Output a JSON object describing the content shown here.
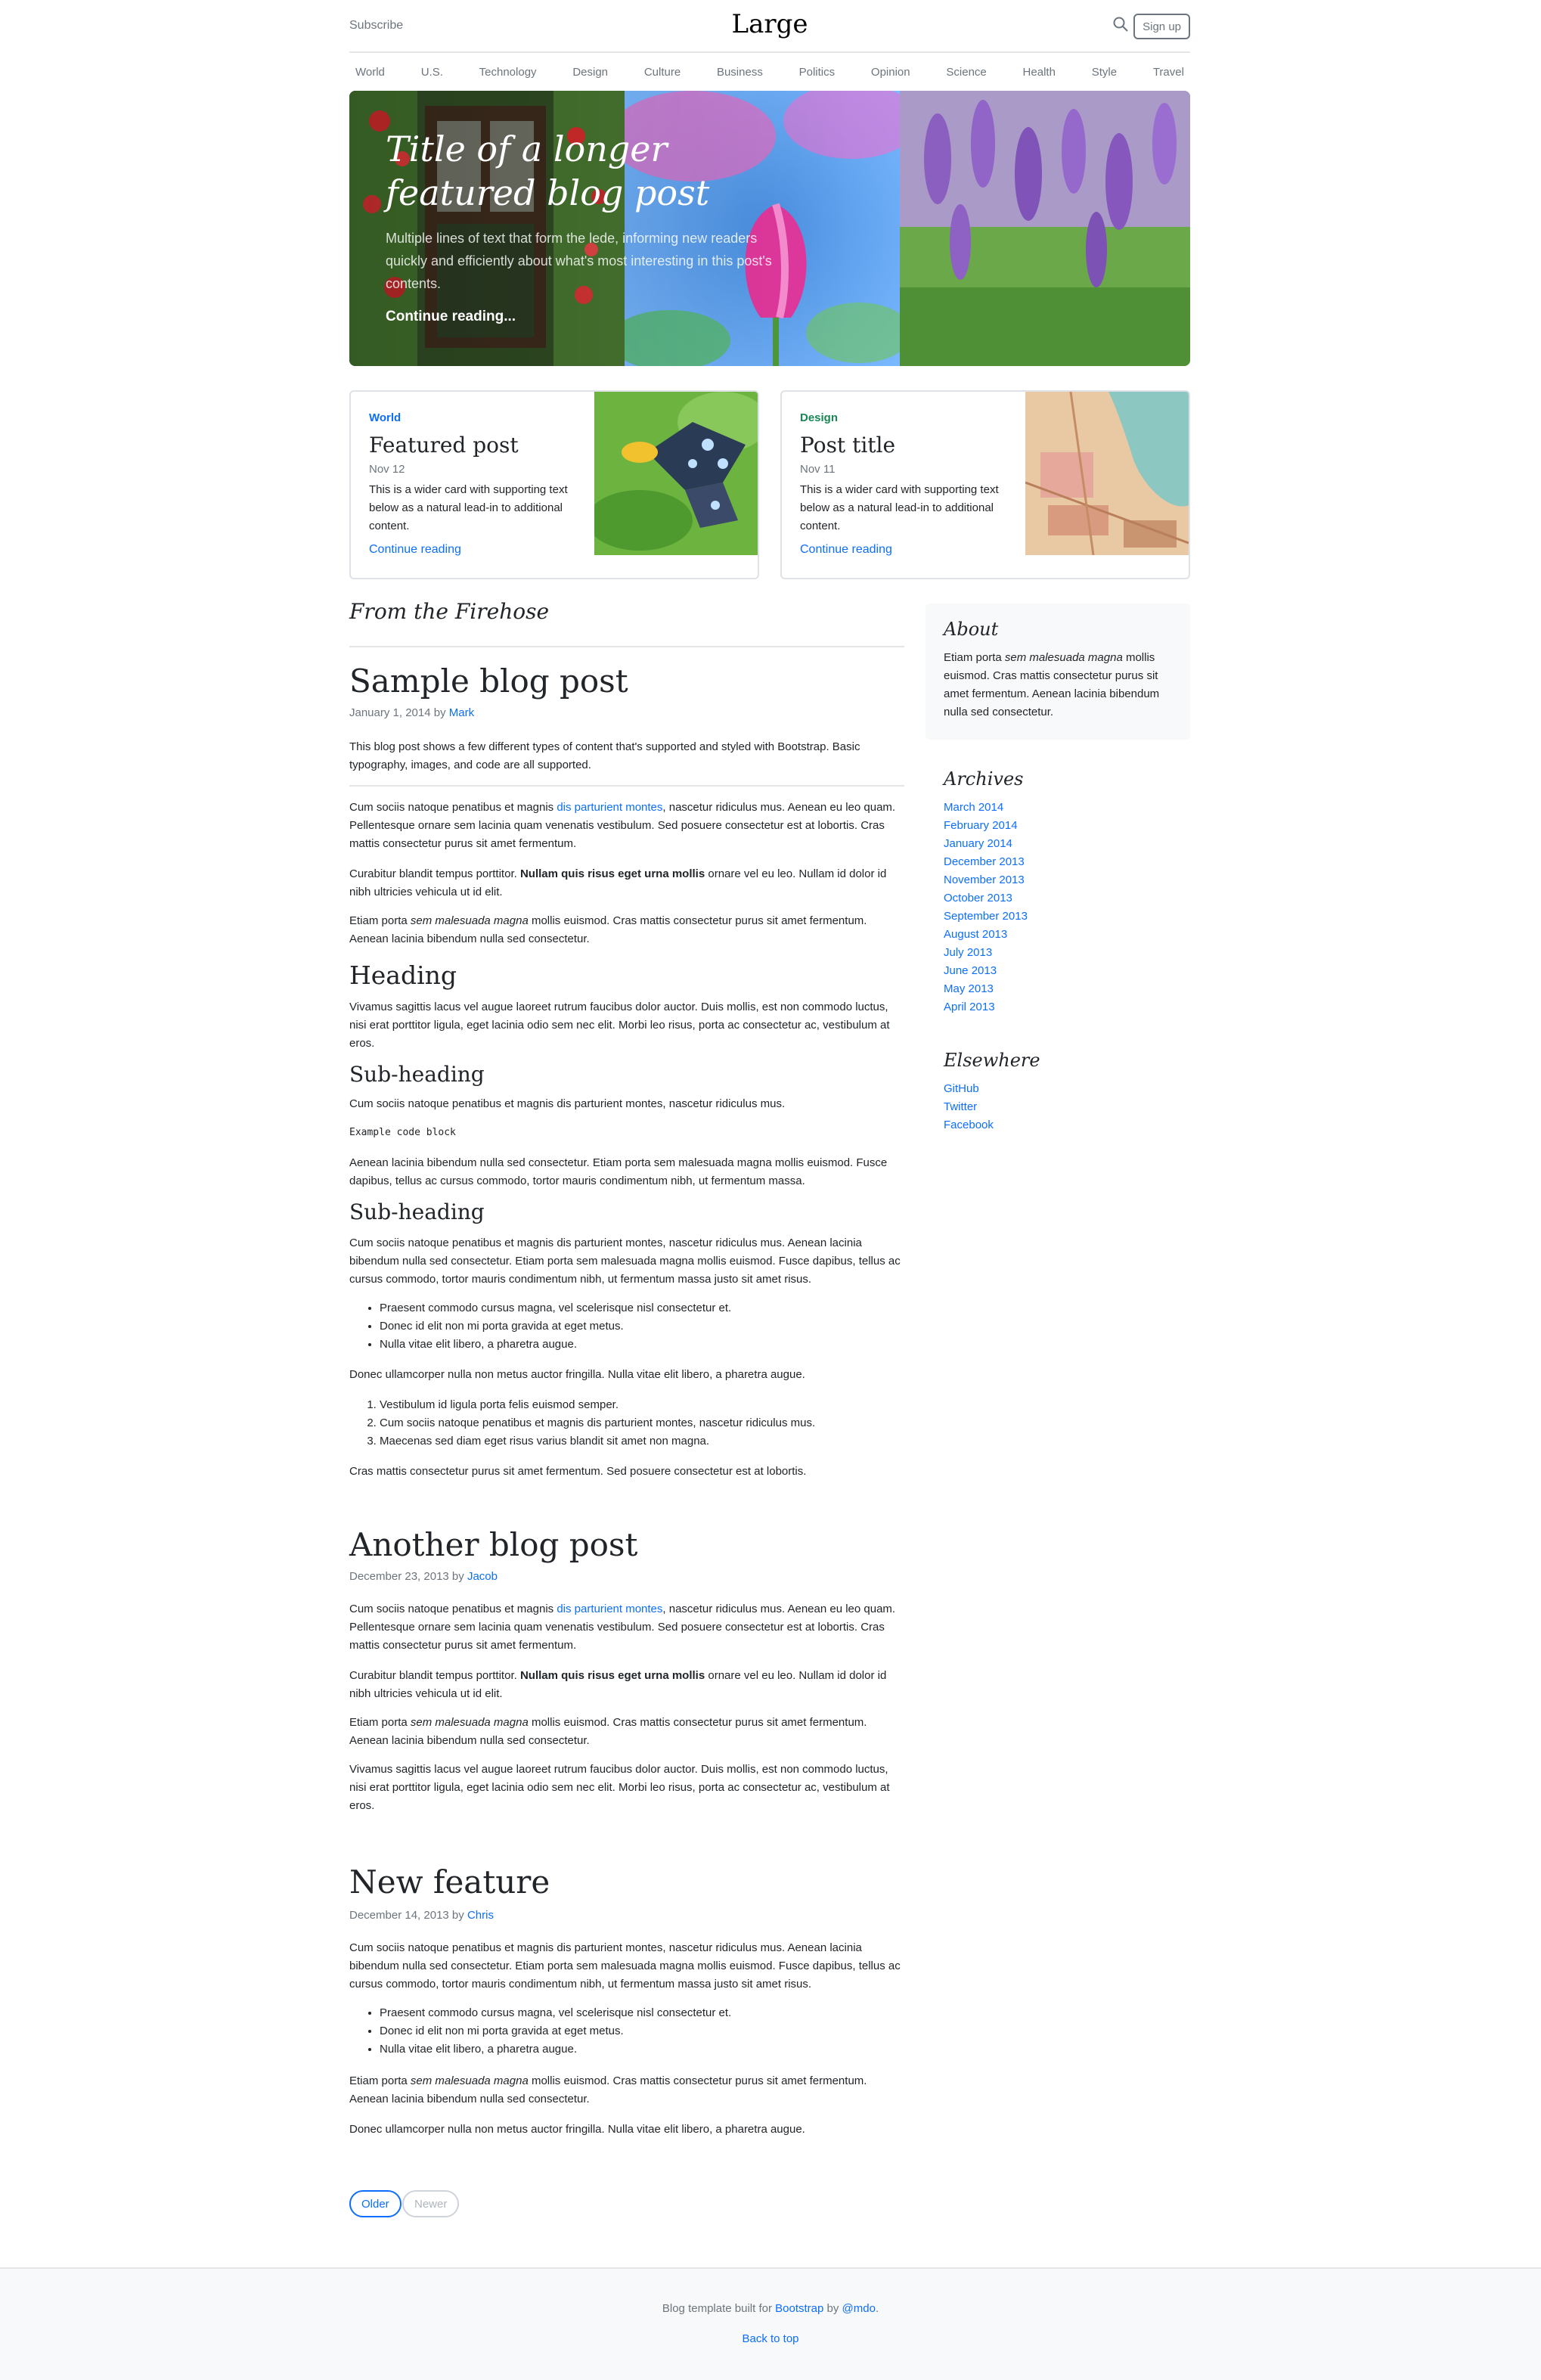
{
  "header": {
    "subscribe": "Subscribe",
    "brand": "Large",
    "signup": "Sign up"
  },
  "nav": [
    "World",
    "U.S.",
    "Technology",
    "Design",
    "Culture",
    "Business",
    "Politics",
    "Opinion",
    "Science",
    "Health",
    "Style",
    "Travel"
  ],
  "hero": {
    "title": "Title of a longer featured blog post",
    "lede": "Multiple lines of text that form the lede, informing new readers quickly and efficiently about what's most interesting in this post's contents.",
    "link": "Continue reading..."
  },
  "cards": [
    {
      "category": "World",
      "category_color": "#0d6efd",
      "title": "Featured post",
      "date": "Nov 12",
      "text": "This is a wider card with supporting text below as a natural lead-in to additional content.",
      "link": "Continue reading"
    },
    {
      "category": "Design",
      "category_color": "#198754",
      "title": "Post title",
      "date": "Nov 11",
      "text": "This is a wider card with supporting text below as a natural lead-in to additional content.",
      "link": "Continue reading"
    }
  ],
  "main": {
    "section_title": "From the Firehose",
    "post1": {
      "title": "Sample blog post",
      "date": "January 1, 2014",
      "by": "by",
      "author": "Mark",
      "intro": "This blog post shows a few different types of content that's supported and styled with Bootstrap. Basic typography, images, and code are all supported.",
      "p1_a": "Cum sociis natoque penatibus et magnis ",
      "p1_link": "dis parturient montes",
      "p1_b": ", nascetur ridiculus mus. Aenean eu leo quam. Pellentesque ornare sem lacinia quam venenatis vestibulum. Sed posuere consectetur est at lobortis. Cras mattis consectetur purus sit amet fermentum.",
      "p2_a": "Curabitur blandit tempus porttitor. ",
      "p2_bold": "Nullam quis risus eget urna mollis",
      "p2_b": " ornare vel eu leo. Nullam id dolor id nibh ultricies vehicula ut id elit.",
      "p3_a": "Etiam porta ",
      "p3_em": "sem malesuada magna",
      "p3_b": " mollis euismod. Cras mattis consectetur purus sit amet fermentum. Aenean lacinia bibendum nulla sed consectetur.",
      "heading": "Heading",
      "p4": "Vivamus sagittis lacus vel augue laoreet rutrum faucibus dolor auctor. Duis mollis, est non commodo luctus, nisi erat porttitor ligula, eget lacinia odio sem nec elit. Morbi leo risus, porta ac consectetur ac, vestibulum at eros.",
      "sub1": "Sub-heading",
      "p5": "Cum sociis natoque penatibus et magnis dis parturient montes, nascetur ridiculus mus.",
      "code": "Example code block",
      "p6": "Aenean lacinia bibendum nulla sed consectetur. Etiam porta sem malesuada magna mollis euismod. Fusce dapibus, tellus ac cursus commodo, tortor mauris condimentum nibh, ut fermentum massa.",
      "sub2": "Sub-heading",
      "p7": "Cum sociis natoque penatibus et magnis dis parturient montes, nascetur ridiculus mus. Aenean lacinia bibendum nulla sed consectetur. Etiam porta sem malesuada magna mollis euismod. Fusce dapibus, tellus ac cursus commodo, tortor mauris condimentum nibh, ut fermentum massa justo sit amet risus.",
      "ul": [
        "Praesent commodo cursus magna, vel scelerisque nisl consectetur et.",
        "Donec id elit non mi porta gravida at eget metus.",
        "Nulla vitae elit libero, a pharetra augue."
      ],
      "p8": "Donec ullamcorper nulla non metus auctor fringilla. Nulla vitae elit libero, a pharetra augue.",
      "ol": [
        "Vestibulum id ligula porta felis euismod semper.",
        "Cum sociis natoque penatibus et magnis dis parturient montes, nascetur ridiculus mus.",
        "Maecenas sed diam eget risus varius blandit sit amet non magna."
      ],
      "p9": "Cras mattis consectetur purus sit amet fermentum. Sed posuere consectetur est at lobortis."
    },
    "post2": {
      "title": "Another blog post",
      "date": "December 23, 2013",
      "by": "by",
      "author": "Jacob",
      "p1_a": "Cum sociis natoque penatibus et magnis ",
      "p1_link": "dis parturient montes",
      "p1_b": ", nascetur ridiculus mus. Aenean eu leo quam. Pellentesque ornare sem lacinia quam venenatis vestibulum. Sed posuere consectetur est at lobortis. Cras mattis consectetur purus sit amet fermentum.",
      "p2_a": "Curabitur blandit tempus porttitor. ",
      "p2_bold": "Nullam quis risus eget urna mollis",
      "p2_b": " ornare vel eu leo. Nullam id dolor id nibh ultricies vehicula ut id elit.",
      "p3_a": "Etiam porta ",
      "p3_em": "sem malesuada magna",
      "p3_b": " mollis euismod. Cras mattis consectetur purus sit amet fermentum. Aenean lacinia bibendum nulla sed consectetur.",
      "p4": "Vivamus sagittis lacus vel augue laoreet rutrum faucibus dolor auctor. Duis mollis, est non commodo luctus, nisi erat porttitor ligula, eget lacinia odio sem nec elit. Morbi leo risus, porta ac consectetur ac, vestibulum at eros."
    },
    "post3": {
      "title": "New feature",
      "date": "December 14, 2013",
      "by": "by",
      "author": "Chris",
      "p1": "Cum sociis natoque penatibus et magnis dis parturient montes, nascetur ridiculus mus. Aenean lacinia bibendum nulla sed consectetur. Etiam porta sem malesuada magna mollis euismod. Fusce dapibus, tellus ac cursus commodo, tortor mauris condimentum nibh, ut fermentum massa justo sit amet risus.",
      "ul": [
        "Praesent commodo cursus magna, vel scelerisque nisl consectetur et.",
        "Donec id elit non mi porta gravida at eget metus.",
        "Nulla vitae elit libero, a pharetra augue."
      ],
      "p2_a": "Etiam porta ",
      "p2_em": "sem malesuada magna",
      "p2_b": " mollis euismod. Cras mattis consectetur purus sit amet fermentum. Aenean lacinia bibendum nulla sed consectetur.",
      "p3": "Donec ullamcorper nulla non metus auctor fringilla. Nulla vitae elit libero, a pharetra augue."
    },
    "pager": {
      "older": "Older",
      "newer": "Newer"
    }
  },
  "sidebar": {
    "about_title": "About",
    "about_a": "Etiam porta ",
    "about_em": "sem malesuada magna",
    "about_b": " mollis euismod. Cras mattis consectetur purus sit amet fermentum. Aenean lacinia bibendum nulla sed consectetur.",
    "archives_title": "Archives",
    "archives": [
      "March 2014",
      "February 2014",
      "January 2014",
      "December 2013",
      "November 2013",
      "October 2013",
      "September 2013",
      "August 2013",
      "July 2013",
      "June 2013",
      "May 2013",
      "April 2013"
    ],
    "elsewhere_title": "Elsewhere",
    "elsewhere": [
      "GitHub",
      "Twitter",
      "Facebook"
    ]
  },
  "footer": {
    "text_a": "Blog template built for ",
    "bootstrap": "Bootstrap",
    "by": " by ",
    "mdo": "@mdo",
    "dot": ".",
    "back_to_top": "Back to top"
  },
  "colors": {
    "accent": "#0d6efd",
    "muted": "#6c757d",
    "design": "#198754",
    "footer_bg": "#f8f9fa"
  },
  "icons": {
    "search": "search-icon"
  }
}
